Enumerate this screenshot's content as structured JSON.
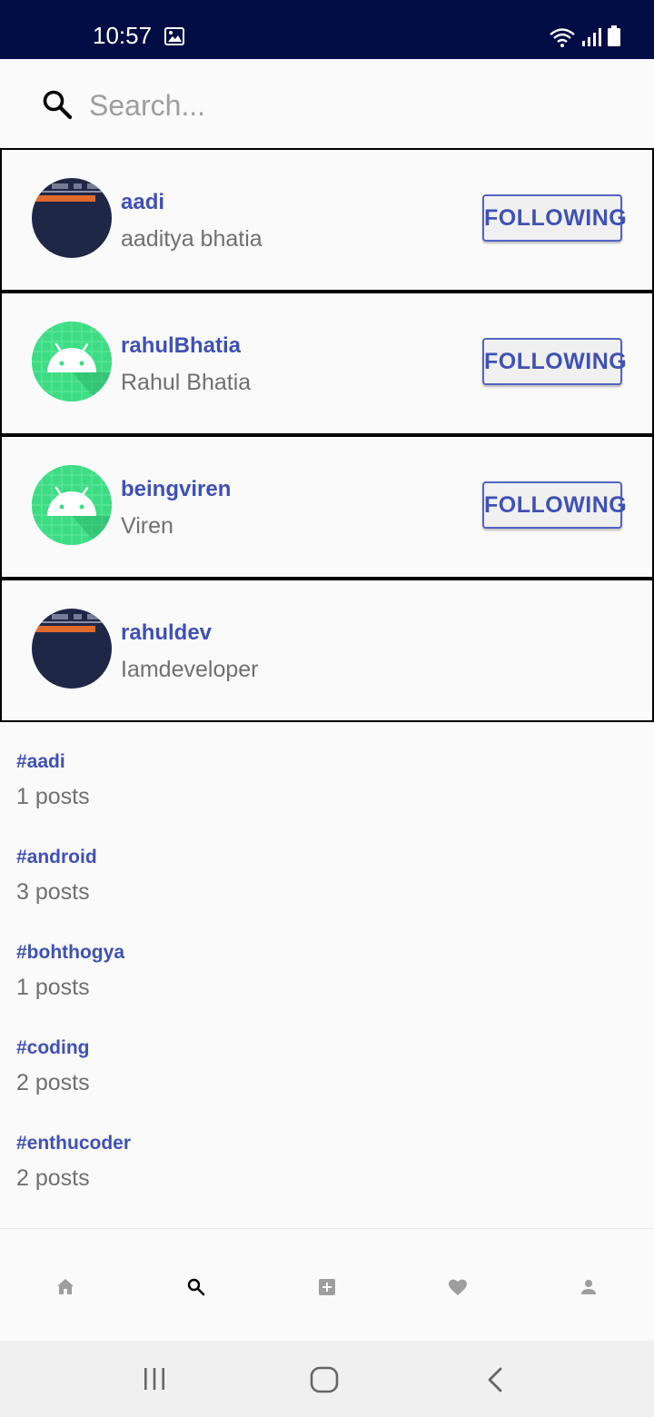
{
  "status_bar": {
    "time": "10:57",
    "icons": [
      "gallery-icon",
      "wifi-icon",
      "signal-icon",
      "battery-icon"
    ]
  },
  "search": {
    "placeholder": "Search..."
  },
  "users": [
    {
      "username": "aadi",
      "fullname": "aaditya bhatia",
      "avatar": "terminal-photo",
      "button": "FOLLOWING"
    },
    {
      "username": "rahulBhatia",
      "fullname": "Rahul Bhatia",
      "avatar": "android-icon",
      "button": "FOLLOWING"
    },
    {
      "username": "beingviren",
      "fullname": "Viren",
      "avatar": "android-icon",
      "button": "FOLLOWING"
    },
    {
      "username": "rahuldev",
      "fullname": "Iamdeveloper",
      "avatar": "terminal-photo"
    }
  ],
  "tags": [
    {
      "name": "#aadi",
      "count": "1 posts"
    },
    {
      "name": "#android",
      "count": "3 posts"
    },
    {
      "name": "#bohthogya",
      "count": "1 posts"
    },
    {
      "name": "#coding",
      "count": "2 posts"
    },
    {
      "name": "#enthucoder",
      "count": "2 posts"
    }
  ],
  "bottom_nav": {
    "items": [
      "home-icon",
      "search-icon",
      "add-post-icon",
      "heart-icon",
      "profile-icon"
    ],
    "active": "search-icon"
  },
  "system_nav": [
    "recent-apps-icon",
    "home-button-icon",
    "back-icon"
  ],
  "colors": {
    "status_bar": "#020c45",
    "accent": "#3f51b5",
    "secondary_text": "#707070",
    "android_green": "#3ddc84"
  }
}
